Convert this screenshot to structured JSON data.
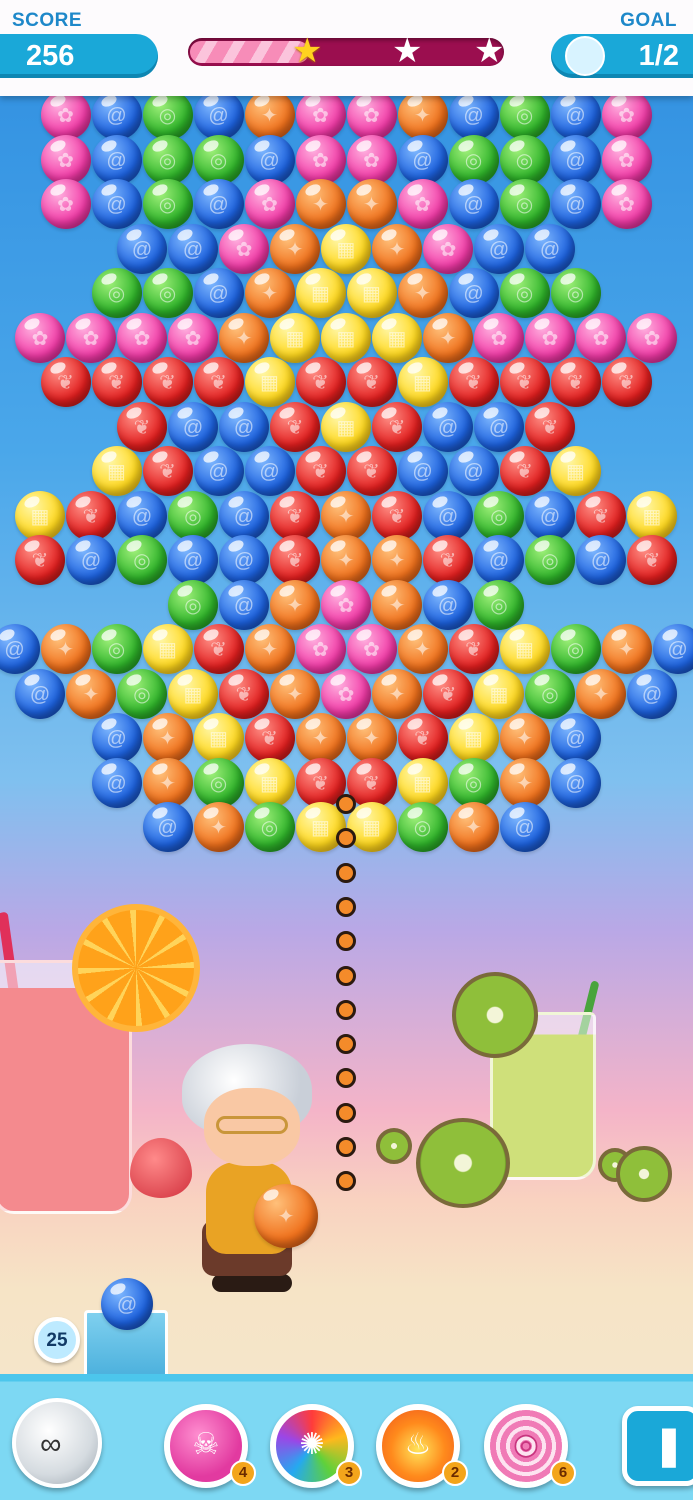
{
  "hud": {
    "score_label": "SCORE",
    "score_value": "256",
    "goal_label": "GOAL",
    "goal_value": "1/2",
    "stars_total": 3,
    "progress_fraction": 0.38,
    "progress_star_earned": 1
  },
  "shooter": {
    "ammo_remaining": "25",
    "current_bubble_color": "blue",
    "held_bubble_color": "orange"
  },
  "boosters": [
    {
      "name": "bomb",
      "count": "4",
      "icon": "skull-bomb-icon",
      "color": "#e23aa0"
    },
    {
      "name": "rainbow",
      "count": "3",
      "icon": "rainbow-swirl-icon",
      "color": "#9b46e6"
    },
    {
      "name": "fireball",
      "count": "2",
      "icon": "fire-icon",
      "color": "#f0561c"
    },
    {
      "name": "lollipop",
      "count": "6",
      "icon": "lollipop-icon",
      "color": "#f07ab6"
    }
  ],
  "controls": {
    "swap_icon": "swap-icon",
    "pause_icon": "pause-icon"
  },
  "colors": {
    "pink": "#f23ba7",
    "blue": "#1d62df",
    "green": "#2fb42a",
    "orange": "#f0711c",
    "yellow": "#ffd81d",
    "red": "#e21f1f"
  },
  "board": {
    "rows": [
      "P B G B O P P O B G B P",
      "P B G G B P P B G G B P",
      "P B G B P O O P B G B P",
      "B B P O Y O P B B",
      "G G B O Y Y O B G G",
      "P P P P O Y Y Y O P P P P",
      "R R R R Y R R Y R R R R",
      "R B B R Y R B B R",
      "Y R B B R R B B R Y",
      "Y R B G B R O R B G B R Y",
      "R B G B B R O O R B G B R",
      "G B O P O B G",
      "B O G Y R O P P O R Y G O B",
      "B O G Y R O P O R Y G O B",
      "B O Y R O O R Y O B",
      "B O G Y R R Y G O B",
      "B O G Y Y G O B"
    ]
  }
}
